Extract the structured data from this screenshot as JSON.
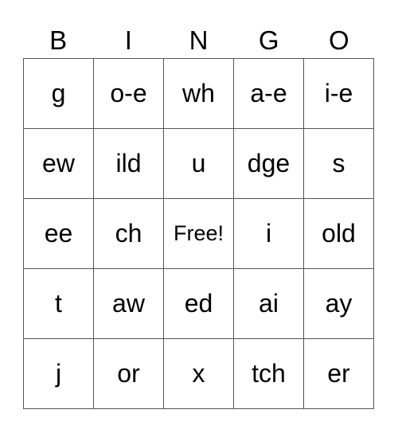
{
  "header": [
    "B",
    "I",
    "N",
    "G",
    "O"
  ],
  "rows": [
    [
      "g",
      "o-e",
      "wh",
      "a-e",
      "i-e"
    ],
    [
      "ew",
      "ild",
      "u",
      "dge",
      "s"
    ],
    [
      "ee",
      "ch",
      "Free!",
      "i",
      "old"
    ],
    [
      "t",
      "aw",
      "ed",
      "ai",
      "ay"
    ],
    [
      "j",
      "or",
      "x",
      "tch",
      "er"
    ]
  ]
}
